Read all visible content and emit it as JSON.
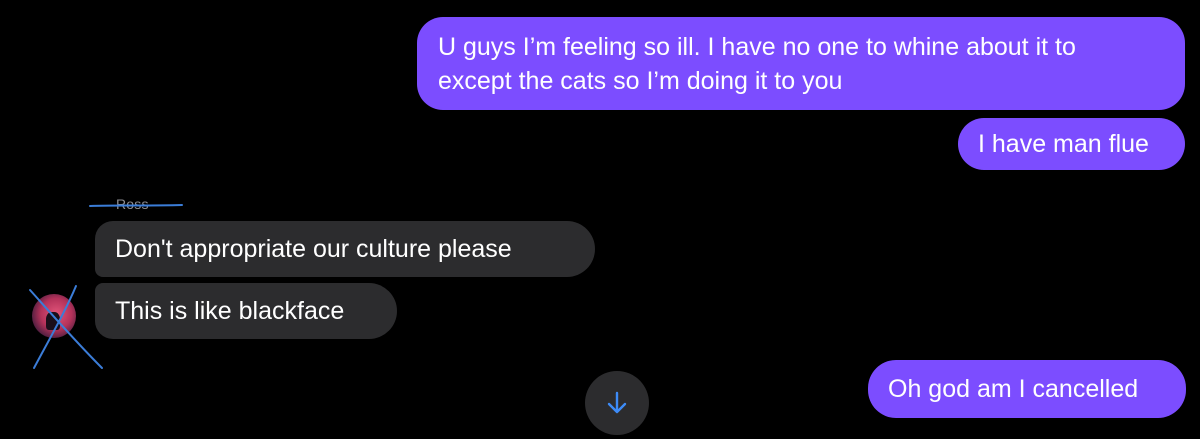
{
  "messages": [
    {
      "direction": "outgoing",
      "lines": [
        "U guys I’m feeling so ill. I have no one to whine about it to",
        "except the cats so I’m doing it to you"
      ]
    },
    {
      "direction": "outgoing",
      "text": "I have man flue"
    },
    {
      "direction": "incoming",
      "sender": "Ross",
      "text": "Don't appropriate our culture please"
    },
    {
      "direction": "incoming",
      "text": "This is like blackface"
    },
    {
      "direction": "outgoing",
      "text": "Oh god am I cancelled"
    }
  ],
  "scroll_button": {
    "icon": "arrow-down-icon"
  },
  "colors": {
    "background": "#000000",
    "outgoing_bubble": "#7c4dff",
    "incoming_bubble": "#2c2c2e",
    "sender_name": "#8e8e93",
    "annotation_ink": "#3b7dd8",
    "scroll_arrow": "#3d8bf7"
  }
}
